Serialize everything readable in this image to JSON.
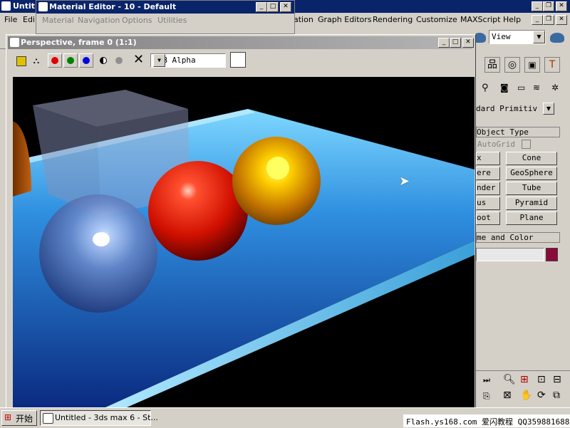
{
  "main_window": {
    "title": "Untit",
    "menu": [
      "File",
      "Edi",
      "ation",
      "Graph Editors",
      "Rendering",
      "Customize",
      "MAXScript",
      "Help"
    ],
    "view_select": "View"
  },
  "material_editor": {
    "title": "Material Editor - 10 - Default",
    "menu": [
      "Material",
      "Navigation",
      "Options",
      "Utilities"
    ]
  },
  "rendered_frame": {
    "title": "Perspective, frame 0 (1:1)",
    "channel_select": "RGB Alpha",
    "channel_colors": {
      "red": "#e00000",
      "green": "#008000",
      "blue": "#0000e0"
    }
  },
  "command_panel": {
    "category_select": "dard Primitiv",
    "object_type": {
      "title": "Object Type",
      "autogrid": "AutoGrid",
      "buttons_left": [
        "x",
        "ere",
        "nder",
        "us",
        "oot"
      ],
      "buttons_right": [
        "Cone",
        "GeoSphere",
        "Tube",
        "Pyramid",
        "Plane"
      ]
    },
    "name_color": {
      "title": "me and Color",
      "color": "#8b0a3a"
    }
  },
  "taskbar": {
    "start": "开始",
    "task": "Untitled - 3ds max 6 - St..."
  },
  "watermark": "Flash.ys168.com 爱闪教程 QQ359881688"
}
